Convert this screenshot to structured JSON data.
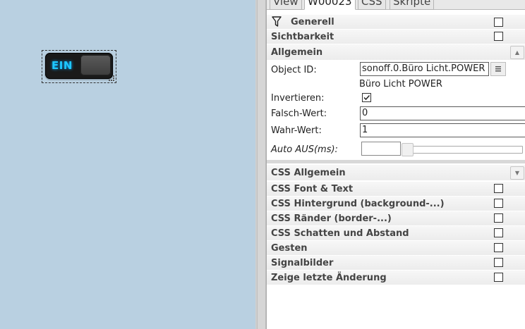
{
  "tabs": [
    "View",
    "W00023",
    "CSS",
    "Skripte"
  ],
  "widget": {
    "label": "EIN"
  },
  "groups_top": [
    {
      "label": "Generell",
      "has_filter_icon": true
    },
    {
      "label": "Sichtbarkeit"
    }
  ],
  "allgemein": {
    "header": "Allgemein",
    "object_id_label": "Object ID:",
    "object_id_value": "sonoff.0.Büro Licht.POWER",
    "object_name": "Büro Licht POWER",
    "invert_label": "Invertieren:",
    "invert_checked": true,
    "false_label": "Falsch-Wert:",
    "false_value": "0",
    "true_label": "Wahr-Wert:",
    "true_value": "1",
    "auto_off_label": "Auto AUS(ms):",
    "auto_off_value": ""
  },
  "css_groups": {
    "header": "CSS Allgemein",
    "items": [
      "CSS Font & Text",
      "CSS Hintergrund (background-...)",
      "CSS Ränder (border-...)",
      "CSS Schatten und Abstand",
      "Gesten",
      "Signalbilder",
      "Zeige letzte Änderung"
    ]
  }
}
